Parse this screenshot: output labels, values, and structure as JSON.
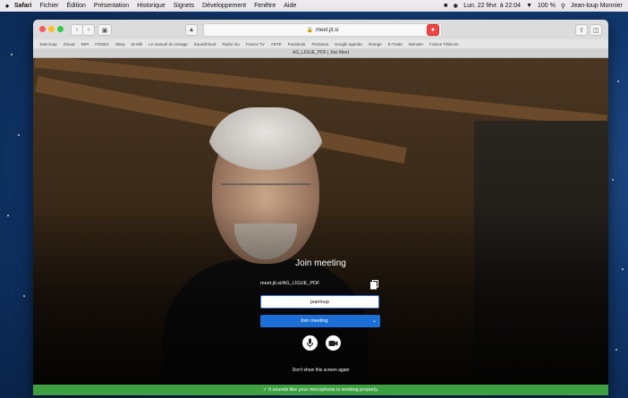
{
  "menubar": {
    "apple": "",
    "items": [
      "Safari",
      "Fichier",
      "Édition",
      "Présentation",
      "Historique",
      "Signets",
      "Développement",
      "Fenêtre",
      "Aide"
    ],
    "clock": "Lun. 22 févr. à 22:04",
    "battery": "100 %",
    "user": "Jean-loup Monnier"
  },
  "browser": {
    "url": "meet.jit.si",
    "bookmarks": [
      "Jean-loup",
      "iCloud",
      "INPI",
      "FONDA",
      "Wiwy",
      "M-Silk",
      "Le manuel du cénage",
      "SoundCloud",
      "Radio Viu",
      "France TV",
      "ARTE",
      "Facebook",
      "Pixmania",
      "Google agenda",
      "Orange",
      "E-Trade",
      "Monster",
      "France Télécom"
    ],
    "tab_title": "AG_LIGUE_PDF | Jitsi Meet"
  },
  "prejoin": {
    "title": "Join meeting",
    "room_url": "meet.jit.si/AG_LIGUE_PDF",
    "name_value": "jeanloup",
    "join_label": "Join meeting",
    "dont_show": "Don't show this screen again",
    "mic_notice": "✓  It sounds like your microphone is working properly."
  },
  "colors": {
    "join": "#1b6fd6",
    "notice": "#3ea043"
  }
}
